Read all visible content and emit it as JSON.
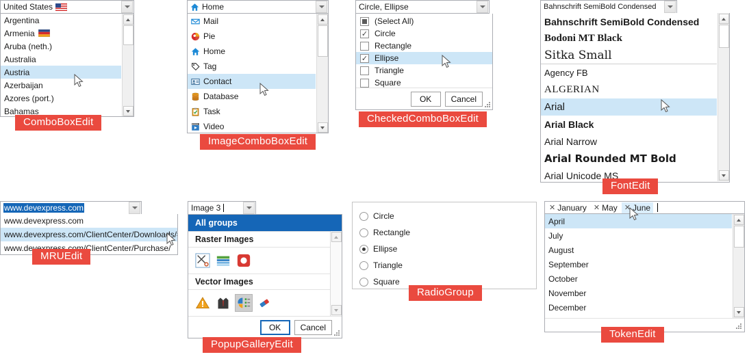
{
  "colors": {
    "badge_red": "#ea4a3f",
    "selection_blue": "#cde6f7",
    "gallery_header_blue": "#1566b7",
    "border_gray": "#abadb3"
  },
  "combo_box_edit": {
    "badge": "ComboBoxEdit",
    "value": "United States",
    "value_flag": "us-flag-icon",
    "items": [
      {
        "label": "Argentina",
        "flag": "",
        "selected": false
      },
      {
        "label": "Armenia",
        "flag": "armenia-flag-icon",
        "selected": false
      },
      {
        "label": "Aruba (neth.)",
        "flag": "",
        "selected": false
      },
      {
        "label": "Australia",
        "flag": "",
        "selected": false
      },
      {
        "label": "Austria",
        "flag": "",
        "selected": true
      },
      {
        "label": "Azerbaijan",
        "flag": "",
        "selected": false
      },
      {
        "label": "Azores (port.)",
        "flag": "",
        "selected": false
      },
      {
        "label": "Bahamas",
        "flag": "",
        "selected": false
      }
    ]
  },
  "image_combo_box_edit": {
    "badge": "ImageComboBoxEdit",
    "value": "Home",
    "value_icon": "home-icon",
    "items": [
      {
        "label": "Mail",
        "icon": "mail-icon",
        "selected": false
      },
      {
        "label": "Pie",
        "icon": "pie-chart-icon",
        "selected": false
      },
      {
        "label": "Home",
        "icon": "home-icon",
        "selected": false
      },
      {
        "label": "Tag",
        "icon": "tag-icon",
        "selected": false
      },
      {
        "label": "Contact",
        "icon": "contact-card-icon",
        "selected": true
      },
      {
        "label": "Database",
        "icon": "database-icon",
        "selected": false
      },
      {
        "label": "Task",
        "icon": "task-clipboard-icon",
        "selected": false
      },
      {
        "label": "Video",
        "icon": "video-icon",
        "selected": false
      }
    ]
  },
  "checked_combo_box_edit": {
    "badge": "CheckedComboBoxEdit",
    "value": "Circle, Ellipse",
    "items": [
      {
        "label": "(Select All)",
        "state": "partial",
        "highlighted": false
      },
      {
        "label": "Circle",
        "state": "checked",
        "highlighted": false
      },
      {
        "label": "Rectangle",
        "state": "unchecked",
        "highlighted": false
      },
      {
        "label": "Ellipse",
        "state": "checked",
        "highlighted": true
      },
      {
        "label": "Triangle",
        "state": "unchecked",
        "highlighted": false
      },
      {
        "label": "Square",
        "state": "unchecked",
        "highlighted": false
      }
    ],
    "ok_label": "OK",
    "cancel_label": "Cancel"
  },
  "font_edit": {
    "badge": "FontEdit",
    "value": "Bahnschrift SemiBold Condensed",
    "items": [
      {
        "label": "Bahnschrift SemiBold Condensed",
        "selected": false,
        "separator_after": false
      },
      {
        "label": "Bodoni MT Black",
        "selected": false,
        "separator_after": false
      },
      {
        "label": "Sitka Small",
        "selected": false,
        "separator_after": true
      },
      {
        "label": "Agency FB",
        "selected": false,
        "separator_after": false
      },
      {
        "label": "ALGERIAN",
        "selected": false,
        "separator_after": false
      },
      {
        "label": "Arial",
        "selected": true,
        "separator_after": false
      },
      {
        "label": "Arial Black",
        "selected": false,
        "separator_after": false
      },
      {
        "label": "Arial Narrow",
        "selected": false,
        "separator_after": false
      },
      {
        "label": "Arial Rounded MT Bold",
        "selected": false,
        "separator_after": false
      },
      {
        "label": "Arial Unicode MS",
        "selected": false,
        "separator_after": false
      }
    ]
  },
  "mru_edit": {
    "badge": "MRUEdit",
    "value": "www.devexpress.com",
    "items": [
      {
        "label": "www.devexpress.com",
        "highlighted": false,
        "show_delete": false
      },
      {
        "label": "www.devexpress.com/ClientCenter/Downloads/#...",
        "highlighted": true,
        "show_delete": true
      },
      {
        "label": "www.devexpress.com/ClientCenter/Purchase/",
        "highlighted": false,
        "show_delete": false
      }
    ]
  },
  "popup_gallery_edit": {
    "badge": "PopupGalleryEdit",
    "value": "Image 3",
    "header": "All groups",
    "groups": [
      {
        "title": "Raster Images",
        "items": [
          {
            "icon": "scissors-icon",
            "selected": false
          },
          {
            "icon": "layers-icon",
            "selected": false
          },
          {
            "icon": "record-icon",
            "selected": false
          }
        ]
      },
      {
        "title": "Vector Images",
        "items": [
          {
            "icon": "warning-icon",
            "selected": false
          },
          {
            "icon": "suit-icon",
            "selected": false
          },
          {
            "icon": "chart-legend-icon",
            "selected": true
          },
          {
            "icon": "eraser-icon",
            "selected": false
          }
        ]
      }
    ],
    "ok_label": "OK",
    "cancel_label": "Cancel"
  },
  "radio_group": {
    "badge": "RadioGroup",
    "items": [
      {
        "label": "Circle",
        "checked": false
      },
      {
        "label": "Rectangle",
        "checked": false
      },
      {
        "label": "Ellipse",
        "checked": true
      },
      {
        "label": "Triangle",
        "checked": false
      },
      {
        "label": "Square",
        "checked": false
      }
    ]
  },
  "token_edit": {
    "badge": "TokenEdit",
    "tokens": [
      {
        "label": "January",
        "hovered": false
      },
      {
        "label": "May",
        "hovered": false
      },
      {
        "label": "June",
        "hovered": true
      }
    ],
    "items": [
      {
        "label": "April",
        "selected": true
      },
      {
        "label": "July",
        "selected": false
      },
      {
        "label": "August",
        "selected": false
      },
      {
        "label": "September",
        "selected": false
      },
      {
        "label": "October",
        "selected": false
      },
      {
        "label": "November",
        "selected": false
      },
      {
        "label": "December",
        "selected": false
      }
    ]
  }
}
